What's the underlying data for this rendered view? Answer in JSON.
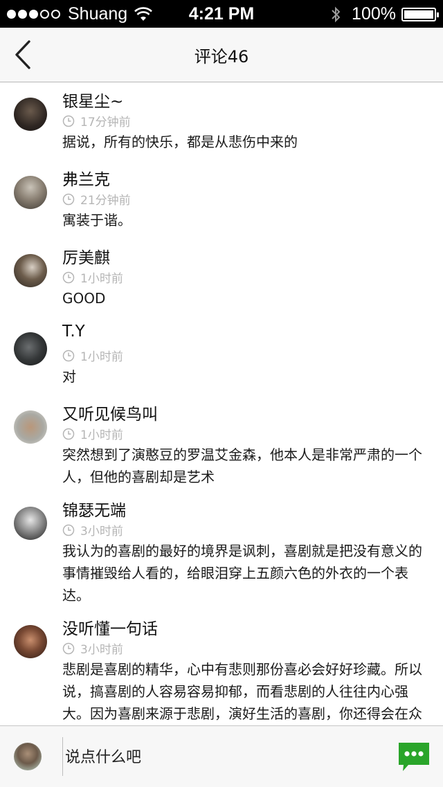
{
  "status_bar": {
    "carrier": "Shuang",
    "time": "4:21 PM",
    "battery": "100%",
    "signal_bars_filled": 3,
    "signal_bars_total": 5
  },
  "navbar": {
    "title": "评论46",
    "back_icon": "chevron-left-icon"
  },
  "comments": [
    {
      "user": "银星尘~",
      "time": "17分钟前",
      "text": "据说，所有的快乐，都是从悲伤中来的"
    },
    {
      "user": "弗兰克",
      "time": "21分钟前",
      "text": "寓装于谐。"
    },
    {
      "user": "厉美麒",
      "time": "1小时前",
      "text": "GOOD"
    },
    {
      "user": "T.Y",
      "time": "1小时前",
      "text": "对"
    },
    {
      "user": "又听见候鸟叫",
      "time": "1小时前",
      "text": "突然想到了演憨豆的罗温艾金森，他本人是非常严肃的一个人，但他的喜剧却是艺术"
    },
    {
      "user": "锦瑟无端",
      "time": "3小时前",
      "text": "我认为的喜剧的最好的境界是讽刺，喜剧就是把没有意义的事情摧毁给人看的，给眼泪穿上五颜六色的外衣的一个表达。"
    },
    {
      "user": "没听懂一句话",
      "time": "3小时前",
      "text": "悲剧是喜剧的精华，心中有悲则那份喜必会好好珍藏。所以说，搞喜剧的人容易容易抑郁，而看悲剧的人往往内心强大。因为喜剧来源于悲剧，演好生活的喜剧，你还得会在众人面前真哭。"
    }
  ],
  "bottom_bar": {
    "placeholder": "说点什么吧",
    "send_icon": "chat-bubble-icon",
    "accent_color": "#2aa52a"
  },
  "colors": {
    "secondary_text": "#b5b5b5",
    "bar_background": "#f7f7f7"
  }
}
